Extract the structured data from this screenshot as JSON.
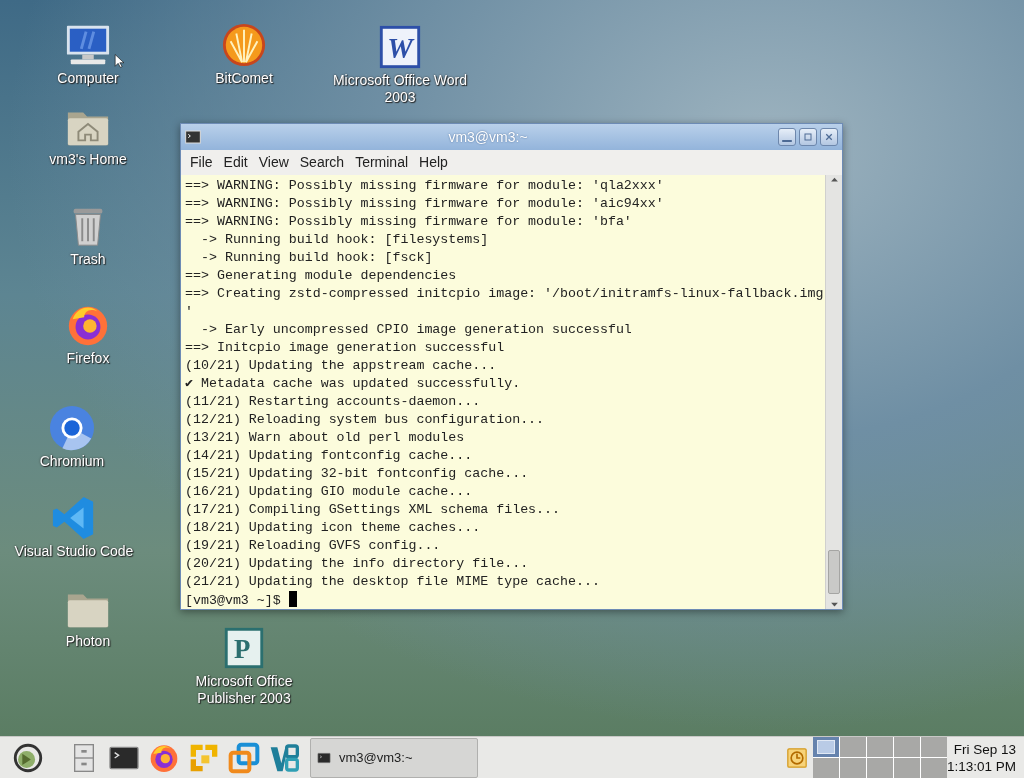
{
  "desktop_icons": [
    {
      "label": "Computer",
      "kind": "computer"
    },
    {
      "label": "BitComet",
      "kind": "bitcomet"
    },
    {
      "label": "Microsoft Office Word 2003",
      "kind": "word",
      "glyph": "W"
    },
    {
      "label": "vm3's Home",
      "kind": "home"
    },
    {
      "label": "Trash",
      "kind": "trash"
    },
    {
      "label": "Firefox",
      "kind": "firefox"
    },
    {
      "label": "Chromium",
      "kind": "chromium"
    },
    {
      "label": "Visual Studio Code",
      "kind": "vscode"
    },
    {
      "label": "Photon",
      "kind": "folder"
    },
    {
      "label": "Microsoft Office Publisher 2003",
      "kind": "publisher",
      "glyph": "P"
    }
  ],
  "terminal": {
    "title": "vm3@vm3:~",
    "menu": [
      "File",
      "Edit",
      "View",
      "Search",
      "Terminal",
      "Help"
    ],
    "lines": [
      "==> WARNING: Possibly missing firmware for module: 'qla2xxx'",
      "==> WARNING: Possibly missing firmware for module: 'aic94xx'",
      "==> WARNING: Possibly missing firmware for module: 'bfa'",
      "  -> Running build hook: [filesystems]",
      "  -> Running build hook: [fsck]",
      "==> Generating module dependencies",
      "==> Creating zstd-compressed initcpio image: '/boot/initramfs-linux-fallback.img",
      "'",
      "  -> Early uncompressed CPIO image generation successful",
      "==> Initcpio image generation successful",
      "(10/21) Updating the appstream cache...",
      "✔ Metadata cache was updated successfully.",
      "(11/21) Restarting accounts-daemon...",
      "(12/21) Reloading system bus configuration...",
      "(13/21) Warn about old perl modules",
      "(14/21) Updating fontconfig cache...",
      "(15/21) Updating 32-bit fontconfig cache...",
      "(16/21) Updating GIO module cache...",
      "(17/21) Compiling GSettings XML schema files...",
      "(18/21) Updating icon theme caches...",
      "(19/21) Reloading GVFS config...",
      "(20/21) Updating the info directory file...",
      "(21/21) Updating the desktop file MIME type cache..."
    ],
    "prompt": "[vm3@vm3 ~]$"
  },
  "taskbar": {
    "launchers": [
      {
        "kind": "menu"
      },
      {
        "kind": "files"
      },
      {
        "kind": "terminal"
      },
      {
        "kind": "firefox"
      },
      {
        "kind": "vmware-workstation"
      },
      {
        "kind": "vmware-player"
      },
      {
        "kind": "vmware-fusion"
      }
    ],
    "tasks": [
      {
        "label": "vm3@vm3:~"
      }
    ],
    "pager": [
      {
        "selected": true
      },
      {
        "selected": false
      },
      {
        "selected": false
      },
      {
        "selected": false
      },
      {
        "selected": false
      },
      {
        "selected": false
      },
      {
        "selected": false
      },
      {
        "selected": false
      },
      {
        "selected": false
      },
      {
        "selected": false
      }
    ],
    "clock": {
      "date": "Fri Sep 13",
      "time": "1:13:01 PM"
    }
  }
}
